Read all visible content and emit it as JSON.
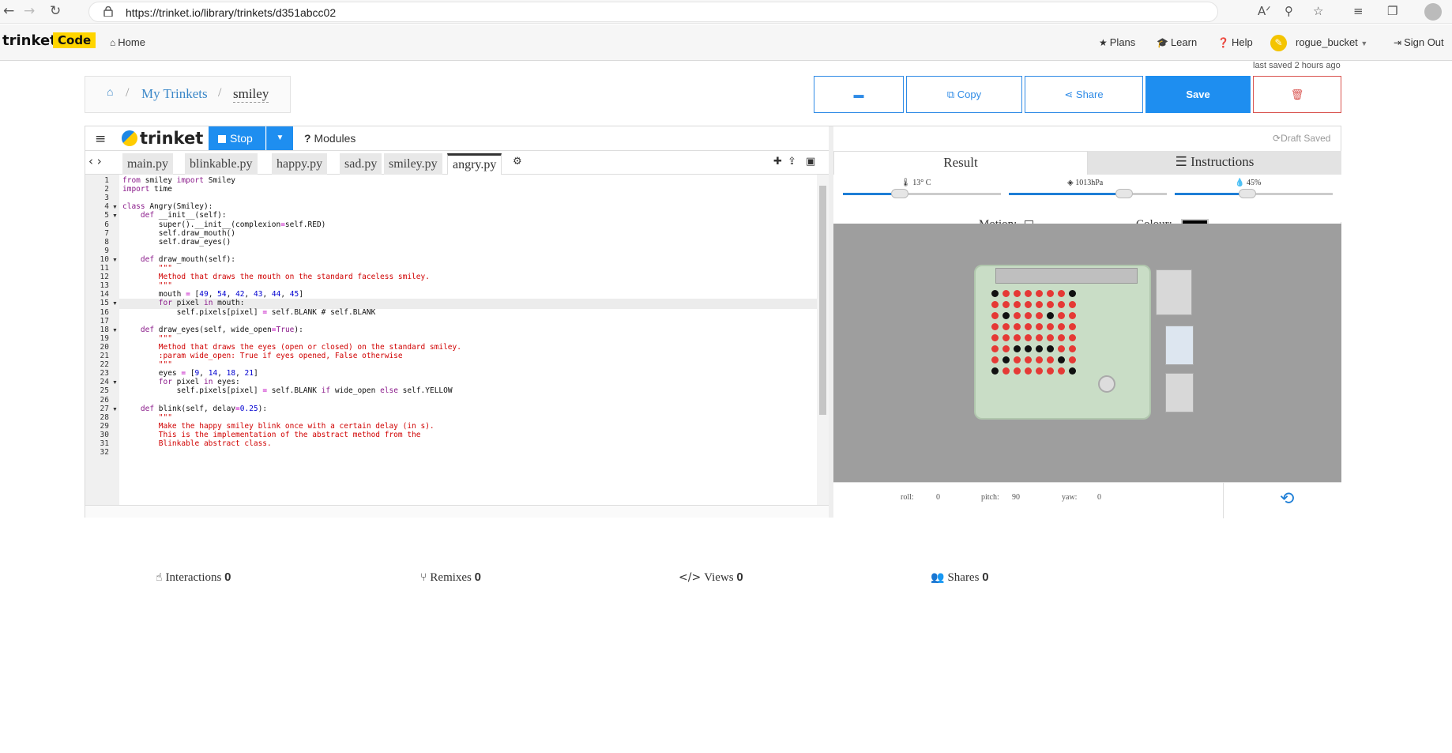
{
  "browser": {
    "url": "https://trinket.io/library/trinkets/d351abcc02",
    "back": "←",
    "forward": "→",
    "reload": "↻"
  },
  "navbar": {
    "brand": "trinket",
    "brand_badge": "Code",
    "home": "Home",
    "plans": "Plans",
    "learn": "Learn",
    "help": "Help",
    "user": "rogue_bucket",
    "signout": "Sign Out"
  },
  "breadcrumb": {
    "my_trinkets": "My Trinkets",
    "current": "smiley"
  },
  "status_saved": "last saved 2 hours ago",
  "toolbar": {
    "copy": "Copy",
    "share": "Share",
    "save": "Save"
  },
  "editor": {
    "logo": "trinket",
    "run_label": "Stop",
    "modules": "Modules",
    "draft": "Draft Saved",
    "tabs": [
      "main.py",
      "blinkable.py",
      "happy.py",
      "sad.py",
      "smiley.py",
      "angry.py"
    ],
    "active_tab": "angry.py",
    "current_line": 15,
    "code": [
      "from smiley import Smiley",
      "import time",
      "",
      "class Angry(Smiley):",
      "    def __init__(self):",
      "        super().__init__(complexion=self.RED)",
      "        self.draw_mouth()",
      "        self.draw_eyes()",
      "",
      "    def draw_mouth(self):",
      "        \"\"\"",
      "        Method that draws the mouth on the standard faceless smiley.",
      "        \"\"\"",
      "        mouth = [49, 54, 42, 43, 44, 45]",
      "        for pixel in mouth:",
      "            self.pixels[pixel] = self.BLANK # self.BLANK",
      "",
      "    def draw_eyes(self, wide_open=True):",
      "        \"\"\"",
      "        Method that draws the eyes (open or closed) on the standard smiley.",
      "        :param wide_open: True if eyes opened, False otherwise",
      "        \"\"\"",
      "        eyes = [9, 14, 18, 21]",
      "        for pixel in eyes:",
      "            self.pixels[pixel] = self.BLANK if wide_open else self.YELLOW",
      "",
      "    def blink(self, delay=0.25):",
      "        \"\"\"",
      "        Make the happy smiley blink once with a certain delay (in s).",
      "        This is the implementation of the abstract method from the",
      "        Blinkable abstract class.",
      ""
    ]
  },
  "result": {
    "tab_result": "Result",
    "tab_instructions": "Instructions",
    "temperature": "13° C",
    "pressure": "1013hPa",
    "humidity": "45%",
    "temperature_level": 0.36,
    "pressure_level": 0.73,
    "humidity_level": 0.46,
    "motion_label": "Motion:",
    "colour_label": "Colour:",
    "colour_value": "#000000",
    "led_matrix": [
      "B R R R R R R B",
      "R R R R R R R R",
      "R B R R R B R R",
      "R R R R R R R R",
      "R R R R R R R R",
      "R R B B B B R R",
      "R B R R R R B R",
      "B R R R R R R B"
    ],
    "roll_label": "roll:",
    "roll": "0",
    "pitch_label": "pitch:",
    "pitch": "90",
    "yaw_label": "yaw:",
    "yaw": "0"
  },
  "stats": {
    "interactions_label": "Interactions",
    "interactions": "0",
    "remixes_label": "Remixes",
    "remixes": "0",
    "views_label": "Views",
    "views": "0",
    "shares_label": "Shares",
    "shares": "0"
  },
  "colors": {
    "accent": "#1e8ef0",
    "brand_yellow": "#ffd500",
    "led_red": "#e53935",
    "danger": "#d9534f"
  }
}
